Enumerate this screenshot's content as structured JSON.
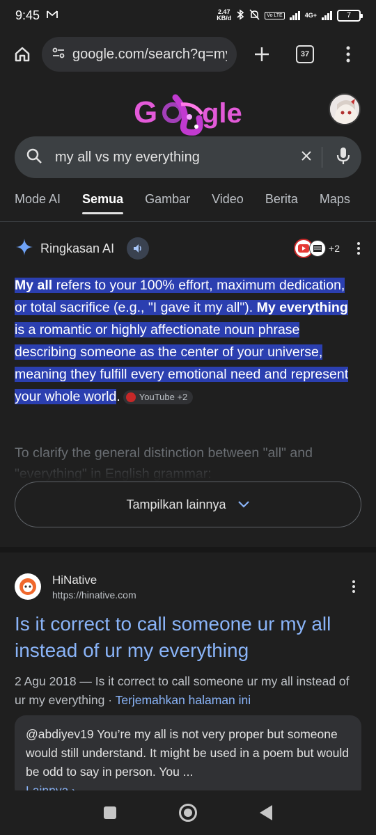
{
  "status_bar": {
    "time": "9:45",
    "speed_value": "2.47",
    "speed_unit": "KB/d",
    "volte": "Vo LTE",
    "network": "4G+",
    "battery": "7"
  },
  "browser": {
    "url": "google.com/search?q=my+",
    "tab_count": "37"
  },
  "google": {
    "logo_text": "Google",
    "search_query": "my all vs my everything"
  },
  "tabs": [
    {
      "label": "Mode AI"
    },
    {
      "label": "Semua"
    },
    {
      "label": "Gambar"
    },
    {
      "label": "Video"
    },
    {
      "label": "Berita"
    },
    {
      "label": "Maps"
    }
  ],
  "ai_overview": {
    "title": "Ringkasan AI",
    "sources_count": "+2",
    "p1_bold1": "My all",
    "p1_text1": " refers to your 100% effort, maximum dedication, or total sacrifice (e.g., \"I gave it my all\"). ",
    "p1_bold2": "My everything",
    "p1_text2": " is a romantic or highly affectionate noun phrase describing someone as the center of your universe, meaning they fulfill every emotional need and represent your whole world",
    "p1_end": ".",
    "chip": "YouTube +2",
    "faded": "To clarify the general distinction between \"all\" and \"everything\" in English grammar:",
    "show_more": "Tampilkan lainnya"
  },
  "result": {
    "site_name": "HiNative",
    "site_url": "https://hinative.com",
    "title": "Is it correct to call someone ur my all instead of ur my everything",
    "snippet": "2 Agu 2018 — Is it correct to call someone ur my all instead of ur my everything",
    "separator": " · ",
    "translate": "Terjemahkan halaman ini",
    "quote": "@abdiyev19 You’re my all is not very proper but someone would still understand. It might be used in a poem but would be odd to say in person. You ...",
    "quote_more": "Lainnya ›"
  }
}
